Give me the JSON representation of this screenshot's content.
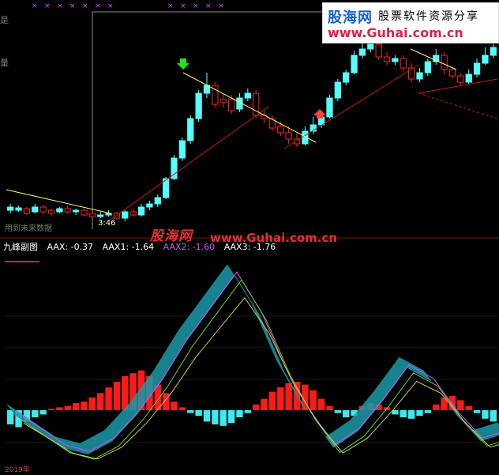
{
  "watermark": {
    "brand_cn": "股海网",
    "slogan_cn": "股票软件资源分享",
    "url_top": "www.Guhai.com.cn",
    "brand_mid": "股海网",
    "url_mid": "www.Guhai.com.cn"
  },
  "indicator": {
    "title": "九峰副图",
    "aax": "AAX: -0.37",
    "aax1": "AAX1: -1.64",
    "aax2": "AAX2: -1.60",
    "aax3": "AAX3: -1.76"
  },
  "labels": {
    "time": "3:46",
    "future": "用到未来数据",
    "date_left": "2019年"
  },
  "colors": {
    "bg": "#000000",
    "up": "#ff2020",
    "down": "#54ffff",
    "ma": "#ffff66",
    "trend": "#c81818",
    "teal": "#1a9aa8",
    "magenta": "#d050ff",
    "green_line": "#66cc33",
    "grid": "#8a1010"
  },
  "chart_data": {
    "type": "candlestick",
    "candles": [
      [
        262,
        266,
        258,
        270,
        0
      ],
      [
        266,
        263,
        260,
        268,
        0
      ],
      [
        264,
        270,
        262,
        272,
        1
      ],
      [
        268,
        262,
        258,
        270,
        0
      ],
      [
        262,
        268,
        260,
        272,
        1
      ],
      [
        266,
        270,
        264,
        274,
        1
      ],
      [
        268,
        264,
        262,
        270,
        0
      ],
      [
        264,
        268,
        260,
        270,
        1
      ],
      [
        268,
        266,
        264,
        272,
        0
      ],
      [
        266,
        272,
        264,
        274,
        1
      ],
      [
        270,
        274,
        268,
        276,
        1
      ],
      [
        274,
        272,
        268,
        276,
        0
      ],
      [
        272,
        270,
        266,
        274,
        0
      ],
      [
        270,
        276,
        268,
        278,
        1
      ],
      [
        276,
        268,
        266,
        280,
        0
      ],
      [
        268,
        272,
        264,
        274,
        1
      ],
      [
        272,
        262,
        258,
        274,
        0
      ],
      [
        262,
        258,
        254,
        266,
        0
      ],
      [
        258,
        250,
        246,
        262,
        0
      ],
      [
        250,
        226,
        224,
        252,
        0
      ],
      [
        226,
        200,
        196,
        228,
        0
      ],
      [
        200,
        178,
        174,
        204,
        0
      ],
      [
        178,
        150,
        146,
        182,
        0
      ],
      [
        150,
        118,
        114,
        154,
        0
      ],
      [
        118,
        108,
        92,
        124,
        0
      ],
      [
        108,
        132,
        104,
        136,
        1
      ],
      [
        130,
        126,
        120,
        136,
        1
      ],
      [
        126,
        140,
        120,
        144,
        1
      ],
      [
        138,
        124,
        118,
        142,
        0
      ],
      [
        124,
        118,
        112,
        128,
        0
      ],
      [
        118,
        146,
        114,
        150,
        1
      ],
      [
        146,
        150,
        140,
        156,
        1
      ],
      [
        150,
        162,
        146,
        166,
        1
      ],
      [
        160,
        168,
        154,
        172,
        1
      ],
      [
        168,
        176,
        160,
        182,
        1
      ],
      [
        176,
        182,
        168,
        186,
        1
      ],
      [
        182,
        166,
        160,
        184,
        0
      ],
      [
        166,
        158,
        148,
        170,
        0
      ],
      [
        158,
        148,
        140,
        162,
        0
      ],
      [
        148,
        124,
        120,
        150,
        0
      ],
      [
        124,
        104,
        100,
        128,
        0
      ],
      [
        104,
        92,
        88,
        108,
        0
      ],
      [
        92,
        70,
        64,
        94,
        0
      ],
      [
        70,
        62,
        54,
        74,
        0
      ],
      [
        62,
        56,
        50,
        66,
        0
      ],
      [
        56,
        72,
        50,
        76,
        1
      ],
      [
        72,
        78,
        66,
        82,
        1
      ],
      [
        78,
        74,
        70,
        82,
        0
      ],
      [
        74,
        86,
        70,
        90,
        1
      ],
      [
        86,
        100,
        80,
        104,
        1
      ],
      [
        100,
        92,
        86,
        104,
        0
      ],
      [
        92,
        78,
        74,
        96,
        0
      ],
      [
        78,
        70,
        62,
        82,
        0
      ],
      [
        70,
        88,
        66,
        94,
        1
      ],
      [
        88,
        96,
        84,
        100,
        1
      ],
      [
        96,
        104,
        92,
        108,
        1
      ],
      [
        104,
        94,
        88,
        106,
        0
      ],
      [
        94,
        80,
        74,
        98,
        0
      ],
      [
        80,
        70,
        60,
        82,
        0
      ],
      [
        70,
        60,
        56,
        74,
        0
      ]
    ],
    "aax": [
      [
        0.0,
        0.2
      ],
      [
        0.05,
        -0.3
      ],
      [
        0.1,
        -0.8
      ],
      [
        0.15,
        -1.0
      ],
      [
        0.2,
        -0.6
      ],
      [
        0.25,
        0.2
      ],
      [
        0.3,
        1.2
      ],
      [
        0.35,
        2.4
      ],
      [
        0.4,
        3.4
      ],
      [
        0.45,
        4.4
      ],
      [
        0.5,
        3.2
      ],
      [
        0.55,
        1.5
      ],
      [
        0.6,
        0.2
      ],
      [
        0.65,
        -0.8
      ],
      [
        0.7,
        -0.3
      ],
      [
        0.75,
        0.6
      ],
      [
        0.8,
        1.6
      ],
      [
        0.85,
        1.2
      ],
      [
        0.9,
        0.2
      ],
      [
        0.95,
        -0.6
      ],
      [
        1.0,
        -0.37
      ]
    ],
    "hist": [
      -1.0,
      -1.2,
      -0.8,
      -0.5,
      -0.3,
      0.1,
      0.2,
      0.3,
      0.5,
      0.6,
      0.9,
      1.2,
      1.6,
      2.0,
      2.4,
      2.6,
      2.8,
      2.4,
      1.8,
      1.2,
      0.6,
      0.2,
      -0.2,
      -0.4,
      -0.8,
      -1.0,
      -1.1,
      -0.9,
      -0.5,
      -0.2,
      0.4,
      0.8,
      1.3,
      1.6,
      1.9,
      2.0,
      1.8,
      1.4,
      0.8,
      0.3,
      -0.2,
      -0.5,
      -0.4,
      0.3,
      0.5,
      0.4,
      0.2,
      -0.3,
      -0.5,
      -0.6,
      -0.4,
      -0.2,
      0.4,
      0.9,
      1.0,
      0.7,
      0.3,
      -0.2,
      -0.6,
      -0.8
    ]
  }
}
